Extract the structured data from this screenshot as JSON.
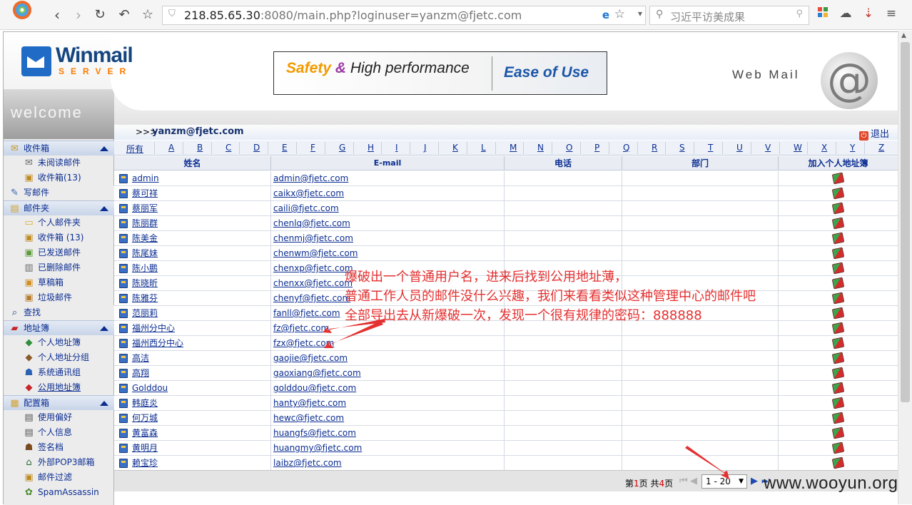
{
  "browser": {
    "address_host": "218.85.65.30",
    "address_rest": ":8080/main.php?loginuser=yanzm@fjetc.com",
    "search_placeholder": "习近平访美成果"
  },
  "header": {
    "logo_main": "Winmail",
    "logo_sub": "SERVER",
    "banner_safety": "Safety",
    "banner_amp": "&",
    "banner_hp": "High performance",
    "banner_ease": "Ease of Use",
    "webmail": "Web Mail",
    "at": "@",
    "welcome": "welcome"
  },
  "user_bar": {
    "prefix": ">>>",
    "user": "yanzm@fjetc.com",
    "logout": "退出"
  },
  "sidebar": {
    "items": [
      {
        "label": "收件箱",
        "icon": "inbox-icon",
        "glyph": "✉",
        "color": "#c79a2a"
      },
      {
        "label": "未阅读邮件",
        "icon": "envelope-icon",
        "glyph": "✉",
        "color": "#6b6b6b"
      },
      {
        "label": "收件箱(13)",
        "icon": "inbox-icon",
        "glyph": "▣",
        "color": "#c08a1e"
      },
      {
        "label": "写邮件",
        "icon": "compose-icon",
        "glyph": "✎",
        "color": "#3a62b0"
      },
      {
        "label": "邮件夹",
        "icon": "folders-icon",
        "glyph": "▤",
        "color": "#d4a431"
      },
      {
        "label": "个人邮件夹",
        "icon": "folder-icon",
        "glyph": "▭",
        "color": "#d7ac2e"
      },
      {
        "label": "收件箱 (13)",
        "icon": "inbox-icon",
        "glyph": "▣",
        "color": "#c08a1e"
      },
      {
        "label": "已发送邮件",
        "icon": "sent-icon",
        "glyph": "▣",
        "color": "#5b9a3a"
      },
      {
        "label": "已删除邮件",
        "icon": "trash-icon",
        "glyph": "▥",
        "color": "#6b6b6b"
      },
      {
        "label": "草稿箱",
        "icon": "drafts-icon",
        "glyph": "▣",
        "color": "#d28e20"
      },
      {
        "label": "垃圾邮件",
        "icon": "junk-icon",
        "glyph": "▣",
        "color": "#b77b27"
      },
      {
        "label": "查找",
        "icon": "search-icon",
        "glyph": "⌕",
        "color": "#1e3f7a"
      },
      {
        "label": "地址簿",
        "icon": "addressbook-icon",
        "glyph": "▰",
        "color": "#c8262a"
      },
      {
        "label": "个人地址簿",
        "icon": "contact-icon",
        "glyph": "◆",
        "color": "#2f8f3a"
      },
      {
        "label": "个人地址分组",
        "icon": "group-icon",
        "glyph": "◆",
        "color": "#8b5a2b"
      },
      {
        "label": "系统通讯组",
        "icon": "users-icon",
        "glyph": "☗",
        "color": "#2c62b5"
      },
      {
        "label": "公用地址簿",
        "icon": "public-addressbook-icon",
        "glyph": "◆",
        "color": "#c8262a"
      },
      {
        "label": "配置箱",
        "icon": "config-icon",
        "glyph": "▦",
        "color": "#d4a431"
      },
      {
        "label": "使用偏好",
        "icon": "preferences-icon",
        "glyph": "▤",
        "color": "#555"
      },
      {
        "label": "个人信息",
        "icon": "profile-icon",
        "glyph": "▤",
        "color": "#555"
      },
      {
        "label": "签名档",
        "icon": "signature-icon",
        "glyph": "☗",
        "color": "#7a4a1f"
      },
      {
        "label": "外部POP3邮箱",
        "icon": "pop3-icon",
        "glyph": "⌂",
        "color": "#2f6a3a"
      },
      {
        "label": "邮件过滤",
        "icon": "filter-icon",
        "glyph": "▣",
        "color": "#c08a1e"
      },
      {
        "label": "SpamAssassin",
        "icon": "spam-icon",
        "glyph": "✿",
        "color": "#4a8a2a"
      }
    ]
  },
  "alpha_bar": [
    "所有",
    "A",
    "B",
    "C",
    "D",
    "E",
    "F",
    "G",
    "H",
    "I",
    "J",
    "K",
    "L",
    "M",
    "N",
    "O",
    "P",
    "Q",
    "R",
    "S",
    "T",
    "U",
    "V",
    "W",
    "X",
    "Y",
    "Z"
  ],
  "table": {
    "headers": [
      "姓名",
      "E-mail",
      "电话",
      "部门",
      "加入个人地址簿"
    ],
    "rows": [
      {
        "name": "admin",
        "email": "admin@fjetc.com"
      },
      {
        "name": "蔡可祥",
        "email": "caikx@fjetc.com"
      },
      {
        "name": "蔡丽军",
        "email": "caili@fjetc.com"
      },
      {
        "name": "陈丽群",
        "email": "chenlq@fjetc.com"
      },
      {
        "name": "陈美金",
        "email": "chenmj@fjetc.com"
      },
      {
        "name": "陈尾妹",
        "email": "chenwm@fjetc.com"
      },
      {
        "name": "陈小鹏",
        "email": "chenxp@fjetc.com"
      },
      {
        "name": "陈晓昕",
        "email": "chenxx@fjetc.com"
      },
      {
        "name": "陈雅芬",
        "email": "chenyf@fjetc.com"
      },
      {
        "name": "范丽莉",
        "email": "fanll@fjetc.com"
      },
      {
        "name": "福州分中心",
        "email": "fz@fjetc.com"
      },
      {
        "name": "福州西分中心",
        "email": "fzx@fjetc.com"
      },
      {
        "name": "高洁",
        "email": "gaojie@fjetc.com"
      },
      {
        "name": "高翔",
        "email": "gaoxiang@fjetc.com"
      },
      {
        "name": "Golddou",
        "email": "golddou@fjetc.com"
      },
      {
        "name": "韩庭炎",
        "email": "hanty@fjetc.com"
      },
      {
        "name": "何万城",
        "email": "hewc@fjetc.com"
      },
      {
        "name": "黄富森",
        "email": "huangfs@fjetc.com"
      },
      {
        "name": "黄明月",
        "email": "huangmy@fjetc.com"
      },
      {
        "name": "赖宝珍",
        "email": "laibz@fjetc.com"
      }
    ]
  },
  "pager": {
    "page_prefix": "第",
    "page_current": "1",
    "page_mid": "页 共",
    "page_total": "4",
    "page_suffix": "页",
    "range": "1 - 20"
  },
  "annotation": {
    "line1": "爆破出一个普通用户名，进来后找到公用地址薄，",
    "line2": "普通工作人员的邮件没什么兴趣，我们来看看类似这种管理中心的邮件吧",
    "line3": "全部导出去从新爆破一次，发现一个很有规律的密码：888888"
  },
  "watermark": "www.wooyun.org",
  "colors": {
    "link": "#0b2d92",
    "annotation": "#e53030",
    "section_bg": "#c7d4e8"
  }
}
